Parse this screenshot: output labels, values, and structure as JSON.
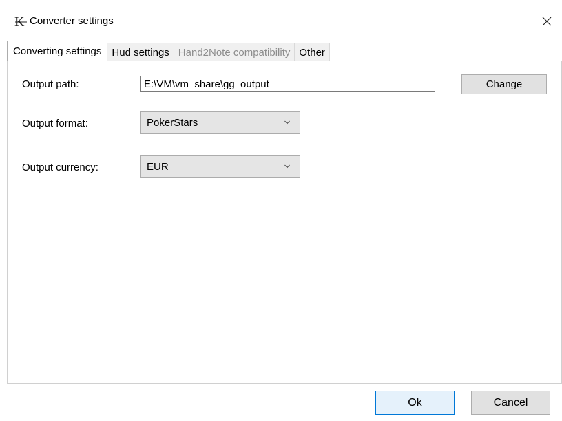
{
  "window": {
    "title": "Converter settings",
    "app_icon": "k-logo-icon",
    "close_icon": "close-icon"
  },
  "tabs": [
    {
      "label": "Converting settings",
      "state": "active"
    },
    {
      "label": "Hud settings",
      "state": "normal"
    },
    {
      "label": "Hand2Note compatibility",
      "state": "disabled"
    },
    {
      "label": "Other",
      "state": "normal"
    }
  ],
  "form": {
    "output_path_label": "Output path:",
    "output_path_value": "E:\\VM\\vm_share\\gg_output",
    "change_label": "Change",
    "output_format_label": "Output format:",
    "output_format_value": "PokerStars",
    "output_currency_label": "Output currency:",
    "output_currency_value": "EUR"
  },
  "footer": {
    "ok_label": "Ok",
    "cancel_label": "Cancel"
  },
  "colors": {
    "default_button_border": "#0078d7",
    "disabled_tab_text": "#8d8d8d"
  }
}
